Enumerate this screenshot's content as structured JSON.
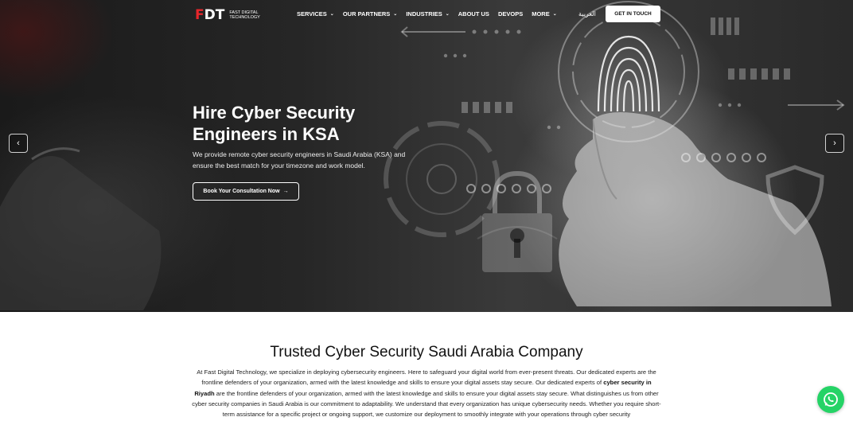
{
  "brand": {
    "mark_f": "F",
    "mark_rest": "DT",
    "name": "FAST DIGITAL TECHNOLOGY"
  },
  "nav": {
    "items": [
      {
        "label": "SERVICES",
        "dropdown": true
      },
      {
        "label": "OUR PARTNERS",
        "dropdown": true
      },
      {
        "label": "INDUSTRIES",
        "dropdown": true
      },
      {
        "label": "ABOUT US",
        "dropdown": false
      },
      {
        "label": "DEVOPS",
        "dropdown": false
      },
      {
        "label": "MORE",
        "dropdown": true
      }
    ],
    "language": "العربية",
    "cta": "GET IN TOUCH"
  },
  "hero": {
    "title": "Hire Cyber Security Engineers in KSA",
    "description": "We provide remote cyber security engineers in Saudi Arabia (KSA) and ensure the best match for your timezone and work model.",
    "button_label": "Book Your Consultation Now",
    "button_arrow": "→",
    "prev_arrow": "‹",
    "next_arrow": "›"
  },
  "section": {
    "title": "Trusted Cyber Security Saudi Arabia Company",
    "p1": "At Fast Digital Technology, we specialize in deploying cybersecurity engineers. Here to safeguard your digital world from ever-present threats. Our dedicated experts are the frontline defenders of your organization, armed with the latest knowledge and skills to ensure your digital assets stay secure. Our dedicated experts of ",
    "bold": "cyber security in Riyadh",
    "p2": " are the frontline defenders of your organization, armed with the latest knowledge and skills to ensure your digital assets stay secure. What distinguishes us from other cyber security companies in Saudi Arabia is our commitment to adaptability. We understand that every organization has unique cybersecurity needs. Whether you require short-term assistance for a specific project or ongoing support, we customize our deployment to smoothly integrate with your operations through cyber security"
  },
  "colors": {
    "brand_red": "#e8262b",
    "whatsapp_green": "#25d366"
  }
}
